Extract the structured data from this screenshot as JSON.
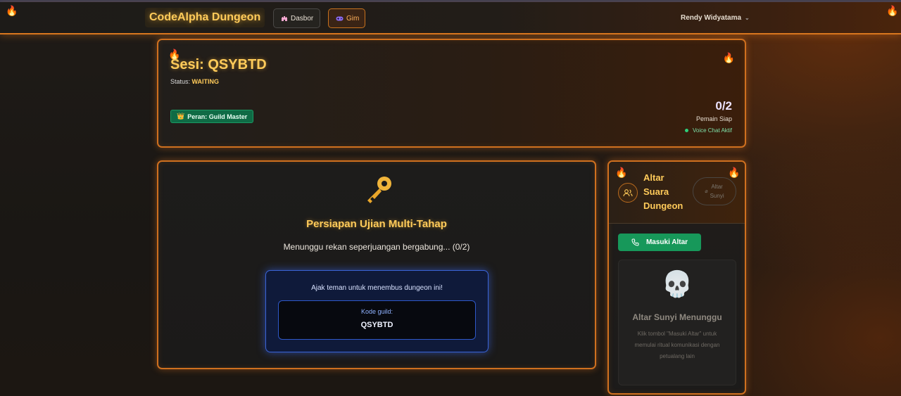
{
  "nav": {
    "brand": "CodeAlpha Dungeon",
    "dashboard_label": "Dasbor",
    "game_label": "Gim",
    "user_name": "Rendy Widyatama"
  },
  "session": {
    "title": "Sesi: QSYBTD",
    "status_label": "Status:",
    "status_value": "WAITING",
    "role_badge": "Peran: Guild Master",
    "ready_count": "0/2",
    "ready_label": "Pemain Siap",
    "voice_status": "Voice Chat Aktif"
  },
  "main": {
    "title": "Persiapan Ujian Multi-Tahap",
    "waiting_text": "Menunggu rekan seperjuangan bergabung... (0/2)",
    "invite_text": "Ajak teman untuk menembus dungeon ini!",
    "code_label": "Kode guild:",
    "code_value": "QSYBTD"
  },
  "voice": {
    "title_line1": "Altar",
    "title_line2": "Suara",
    "title_line3": "Dungeon",
    "silent_line1": "Altar",
    "silent_line2": "Sunyi",
    "enter_button": "Masuki Altar",
    "empty_title": "Altar Sunyi Menunggu",
    "empty_desc": "Klik tombol \"Masuki Altar\" untuk memulai ritual komunikasi dengan petualang lain"
  },
  "icons": {
    "flame": "🔥",
    "crown": "👑",
    "skull": "💀"
  },
  "colors": {
    "accent_gold": "#ffcb5a",
    "accent_orange": "#cf701f",
    "success_green": "#17985a",
    "invite_blue": "#3a64d8"
  }
}
